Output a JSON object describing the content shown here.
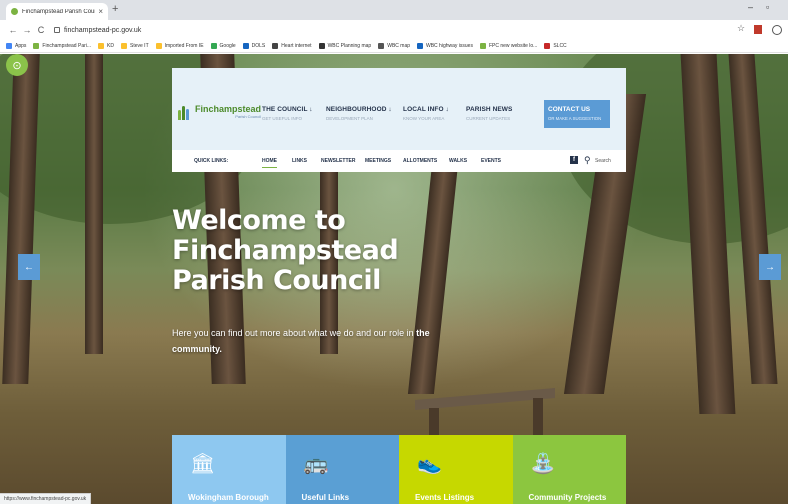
{
  "browser": {
    "tab_title": "Finchampstead Parish Council –",
    "tab_close": "×",
    "new_tab": "+",
    "minimize": "–",
    "restore": "▫",
    "url": "finchampstead-pc.gov.uk",
    "status_url": "https://www.finchampstead-pc.gov.uk",
    "bookmarks": [
      {
        "label": "Apps",
        "color": "#4285f4"
      },
      {
        "label": "Finchampstead Pari...",
        "color": "#7cb342"
      },
      {
        "label": "KD",
        "color": "#fbc02d"
      },
      {
        "label": "Steve IT",
        "color": "#fbc02d"
      },
      {
        "label": "Imported From IE",
        "color": "#fbc02d"
      },
      {
        "label": "Google",
        "color": "#34a853"
      },
      {
        "label": "DOLS",
        "color": "#1565c0"
      },
      {
        "label": "Heart internet",
        "color": "#444444"
      },
      {
        "label": "WBC Planning map",
        "color": "#333333"
      },
      {
        "label": "WBC map",
        "color": "#555555"
      },
      {
        "label": "WBC highway issues",
        "color": "#1565c0"
      },
      {
        "label": "FPC new website lo...",
        "color": "#7cb342"
      },
      {
        "label": "SLCC",
        "color": "#c62828"
      }
    ]
  },
  "site": {
    "brand_name": "Finchampstead",
    "brand_sub": "Parish Council",
    "main_nav": [
      {
        "title": "THE COUNCIL ↓",
        "sub": "GET USEFUL INFO"
      },
      {
        "title": "NEIGHBOURHOOD ↓",
        "sub": "DEVELOPMENT PLAN"
      },
      {
        "title": "LOCAL INFO  ↓",
        "sub": "KNOW YOUR AREA"
      },
      {
        "title": "PARISH NEWS",
        "sub": "CURRENT UPDATES"
      }
    ],
    "contact": {
      "title": "CONTACT US",
      "sub": "OR MAKE A SUGGESTION"
    },
    "quick_label": "QUICK LINKS:",
    "quick_links": [
      "HOME",
      "LINKS",
      "NEWSLETTER",
      "MEETINGS",
      "ALLOTMENTS",
      "WALKS",
      "EVENTS"
    ],
    "search_label": "Search",
    "hero": {
      "title_lines": [
        "Welcome to",
        "Finchampstead",
        "Parish Council"
      ],
      "subtitle_pre": "Here you can find out more about what we do and our role in ",
      "subtitle_bold": "the community."
    },
    "tiles": [
      {
        "label": "Wokingham Borough",
        "color": "#8ec8f0",
        "icon": "building-icon",
        "glyph": "🏛"
      },
      {
        "label": "Useful Links",
        "color": "#5a9fd4",
        "icon": "bus-icon",
        "glyph": "🚌"
      },
      {
        "label": "Events Listings",
        "color": "#c6d800",
        "icon": "shoe-icon",
        "glyph": "👟"
      },
      {
        "label": "Community Projects",
        "color": "#8cc63f",
        "icon": "playground-icon",
        "glyph": "⛲"
      }
    ]
  }
}
